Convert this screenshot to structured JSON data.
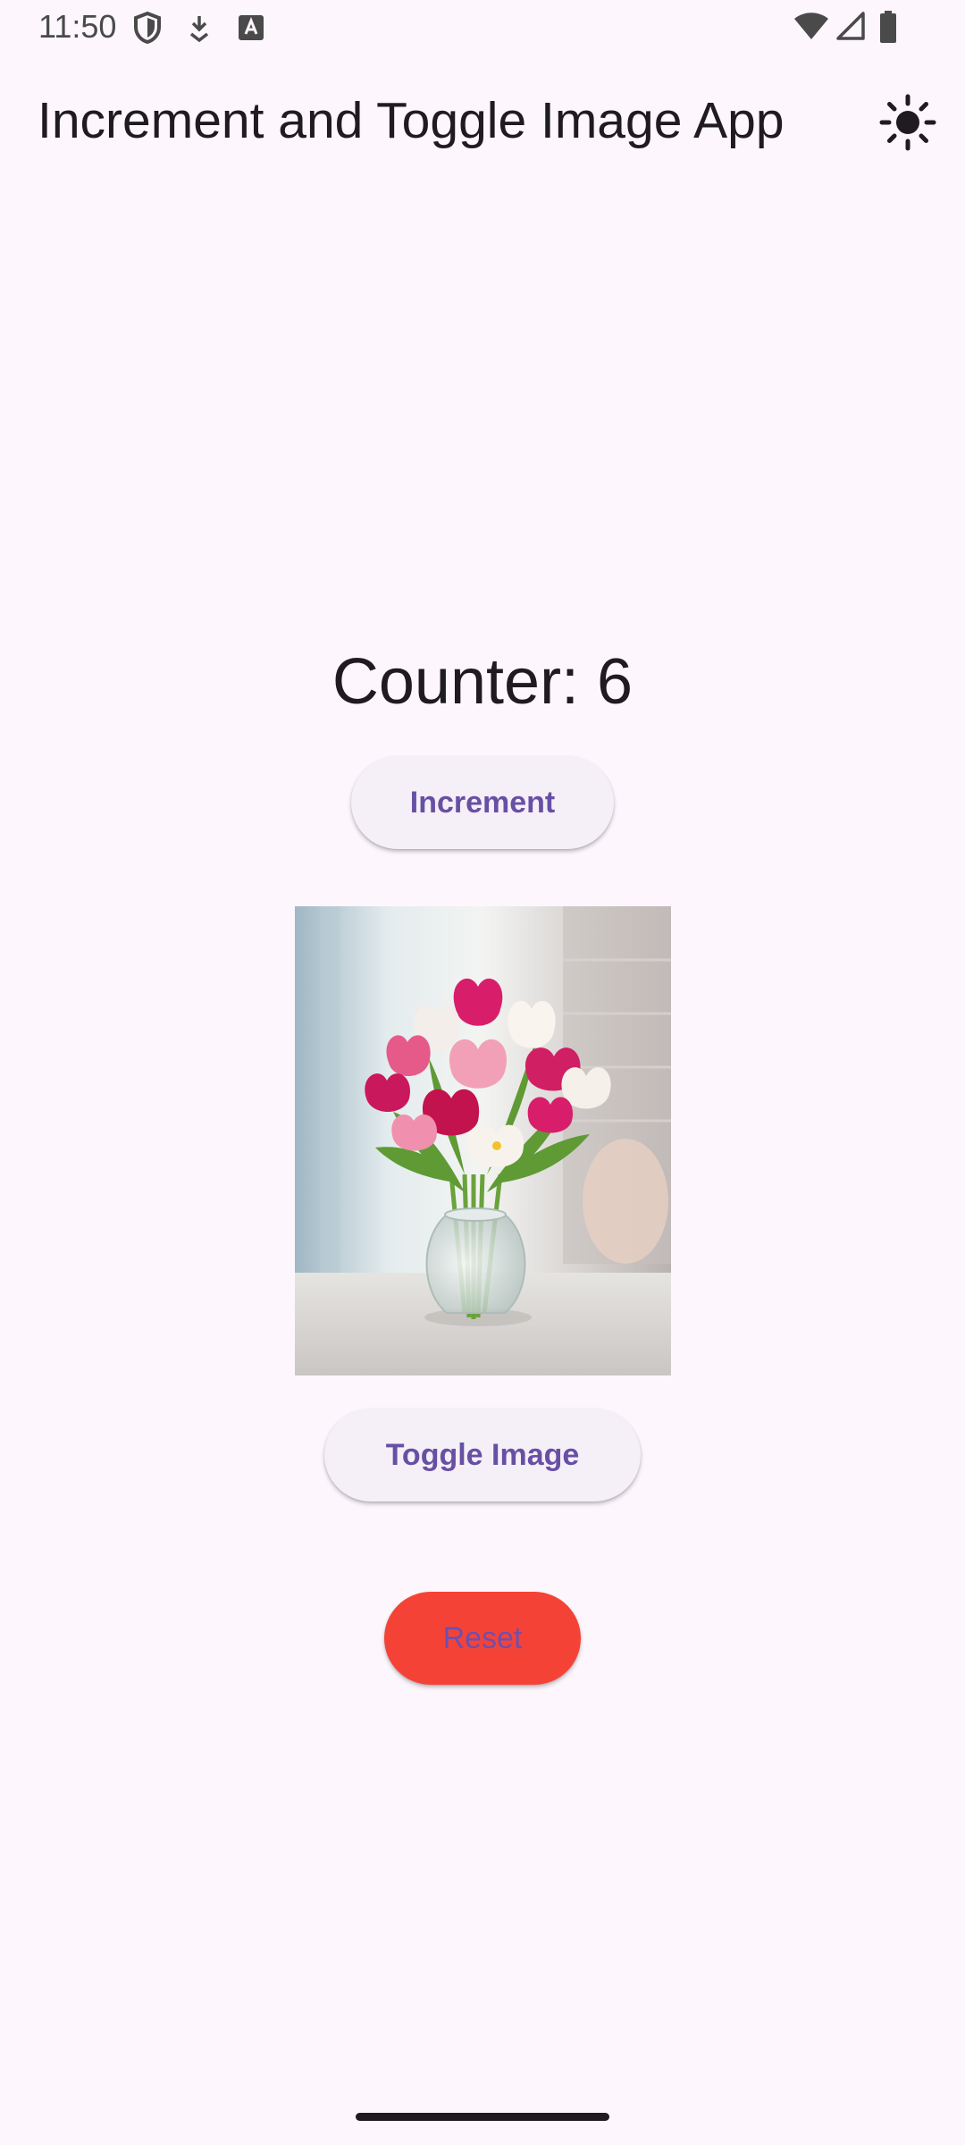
{
  "status_bar": {
    "time": "11:50",
    "left_icons": [
      "shield-icon",
      "download-icon",
      "keyboard-a-icon"
    ],
    "right_icons": [
      "wifi-icon",
      "cell-signal-icon",
      "battery-icon"
    ]
  },
  "app_bar": {
    "title": "Increment and Toggle Image App",
    "action_icon": "sun-icon"
  },
  "counter": {
    "text": "Counter: 6"
  },
  "buttons": {
    "increment_label": "Increment",
    "toggle_label": "Toggle Image",
    "reset_label": "Reset"
  },
  "image": {
    "subject": "tulip bouquet in glass vase"
  },
  "colors": {
    "background": "#fdf7fd",
    "accent": "#6750a4",
    "button_surface": "#f5eff7",
    "reset_button": "#f44336"
  }
}
